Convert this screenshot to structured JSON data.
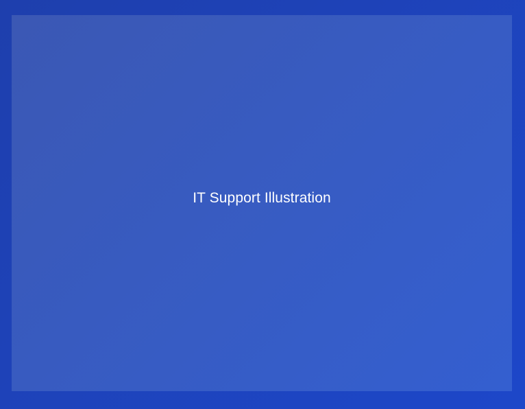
{
  "illustration": {
    "placeholder_text": "IT Support Illustration"
  },
  "colors": {
    "outer_background": "#1e44bd",
    "panel_background": "#365bc3",
    "text": "#ffffff"
  }
}
